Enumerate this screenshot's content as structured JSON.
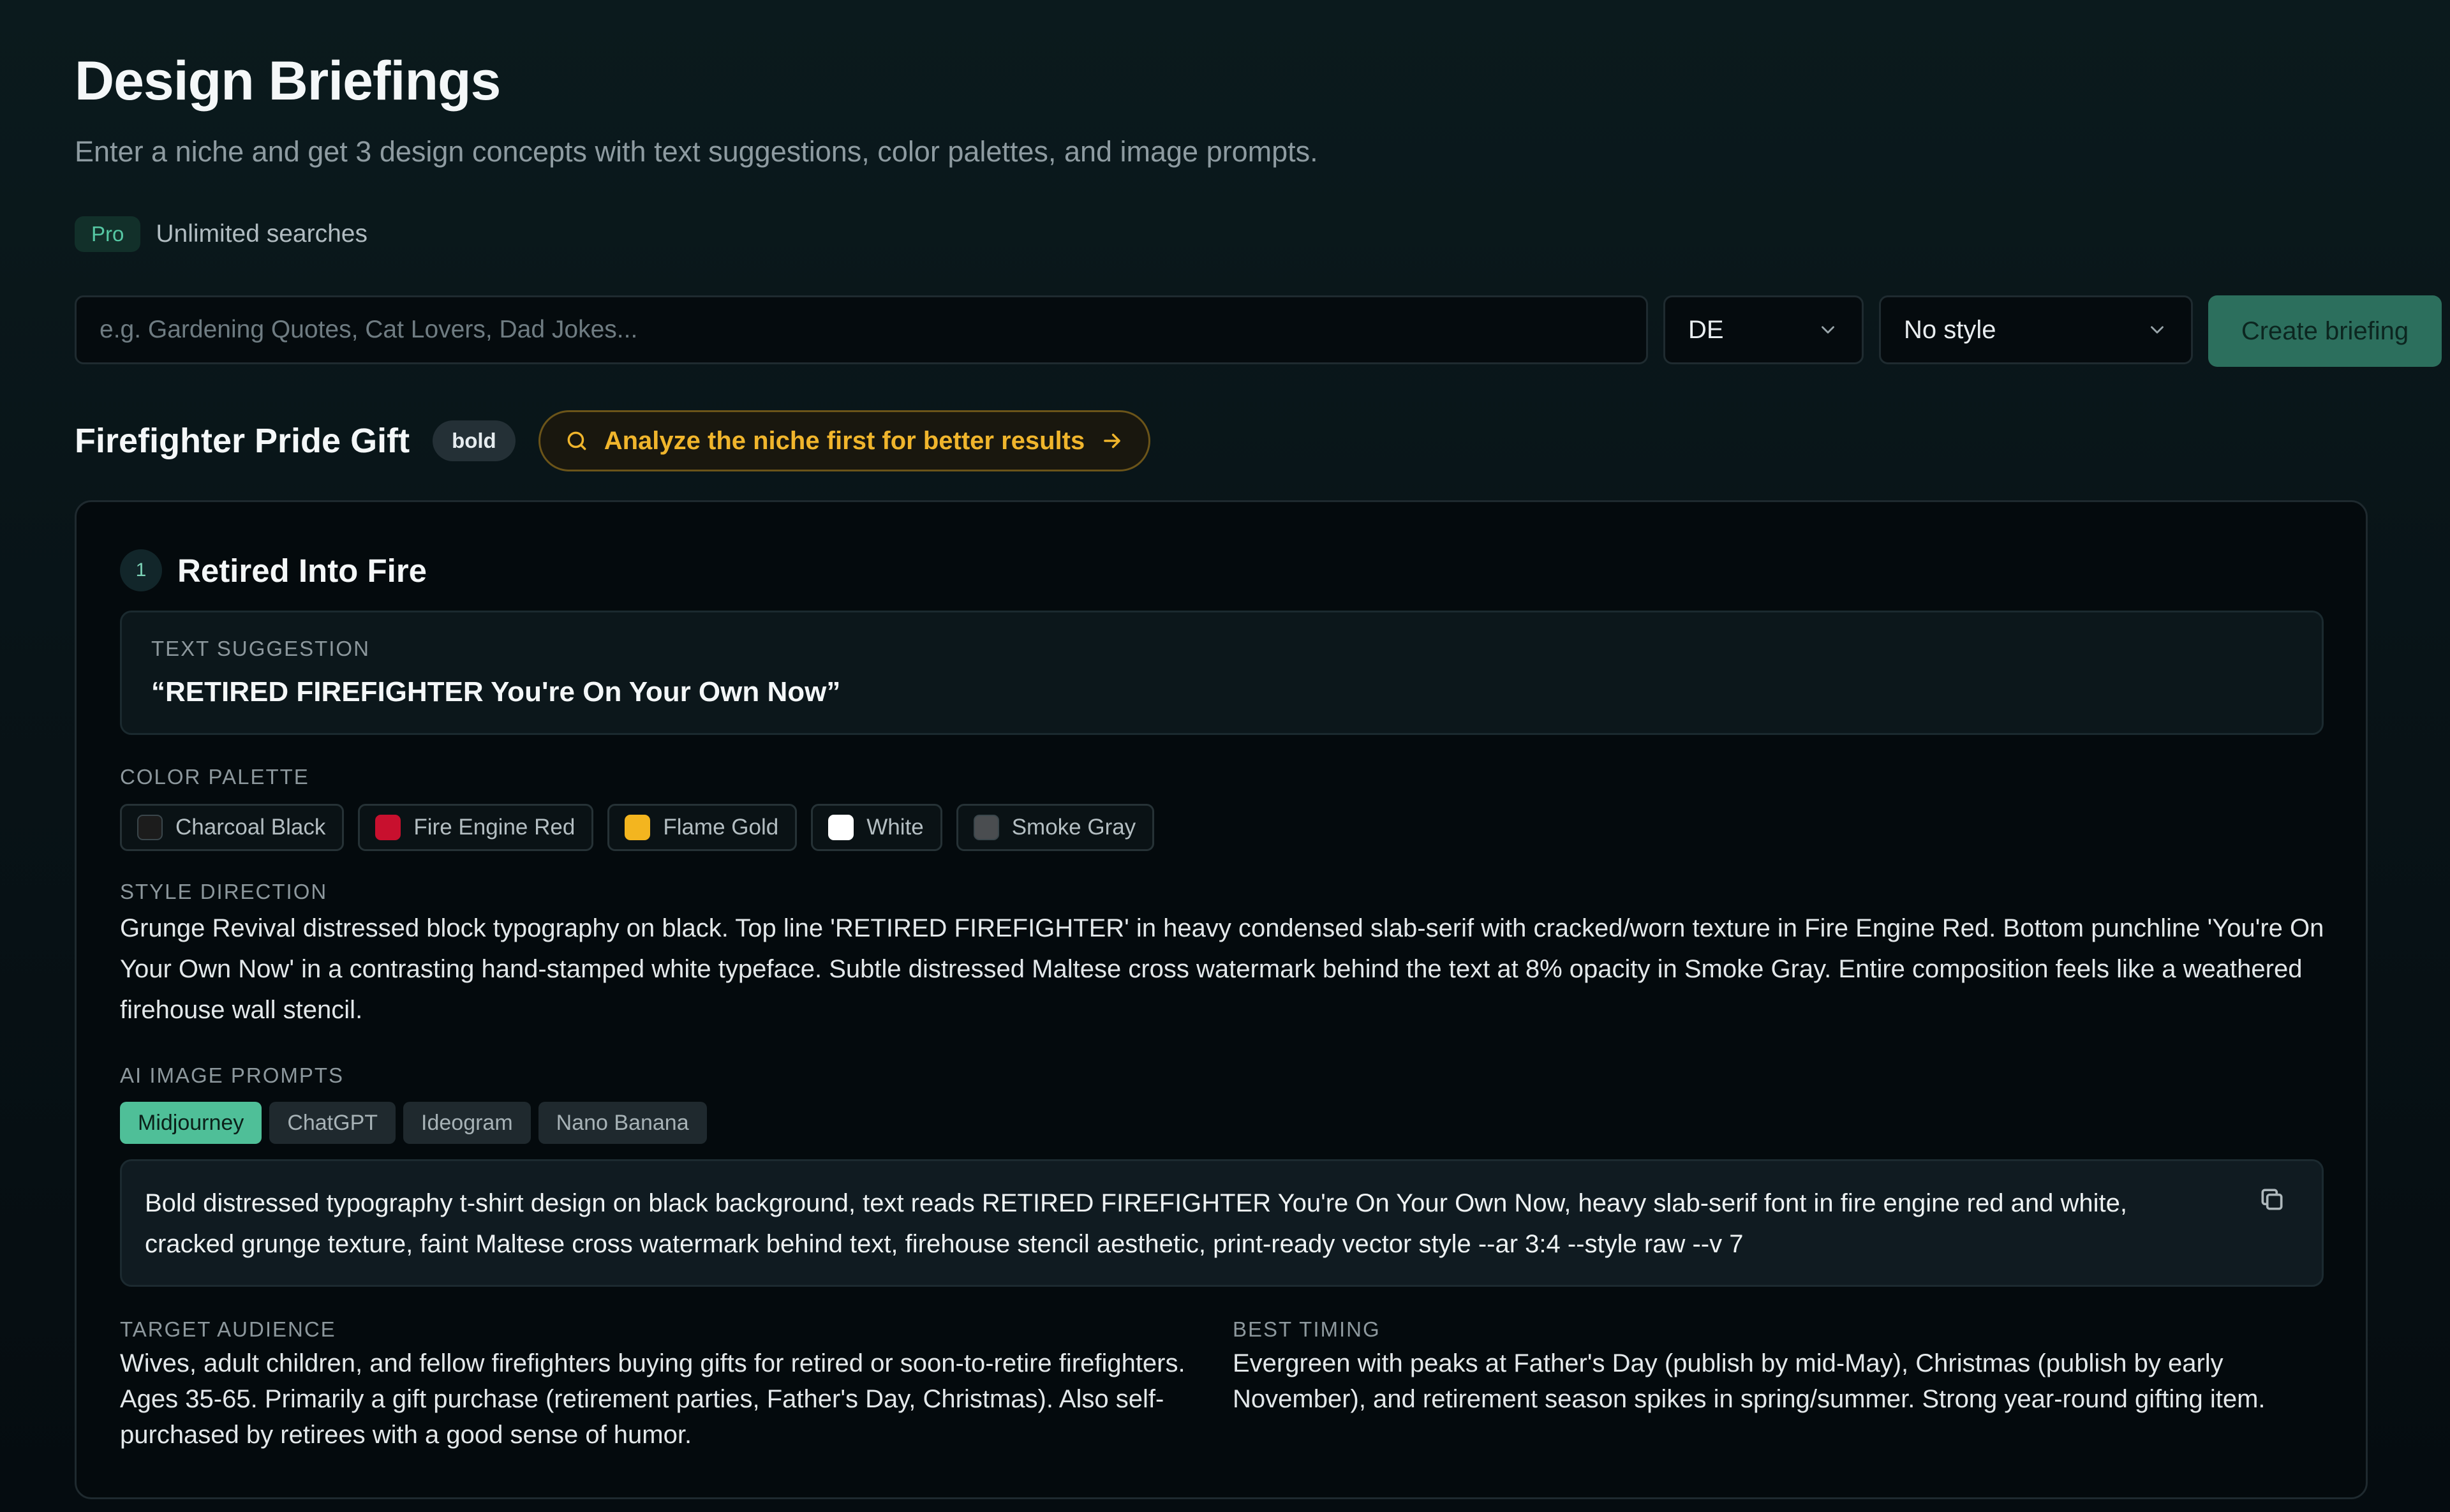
{
  "header": {
    "title": "Design Briefings",
    "subtitle": "Enter a niche and get 3 design concepts with text suggestions, color palettes, and image prompts."
  },
  "plan": {
    "badge": "Pro",
    "text": "Unlimited searches"
  },
  "search": {
    "placeholder": "e.g. Gardening Quotes, Cat Lovers, Dad Jokes...",
    "value": "",
    "language": "DE",
    "style": "No style",
    "create_label": "Create briefing"
  },
  "niche": {
    "title": "Firefighter Pride Gift",
    "tag": "bold",
    "analyze_label": "Analyze the niche first for better results"
  },
  "concept": {
    "number": "1",
    "title": "Retired Into Fire",
    "text_label": "Text Suggestion",
    "text": "“RETIRED FIREFIGHTER You're On Your Own Now”",
    "palette_label": "Color Palette",
    "palette": [
      {
        "name": "Charcoal Black",
        "color": "#1c1c1c"
      },
      {
        "name": "Fire Engine Red",
        "color": "#c8102e"
      },
      {
        "name": "Flame Gold",
        "color": "#f3b51f"
      },
      {
        "name": "White",
        "color": "#ffffff"
      },
      {
        "name": "Smoke Gray",
        "color": "#4a4d50"
      }
    ],
    "style_label": "Style Direction",
    "style_text": "Grunge Revival distressed block typography on black. Top line 'RETIRED FIREFIGHTER' in heavy condensed slab-serif with cracked/worn texture in Fire Engine Red. Bottom punchline 'You're On Your Own Now' in a contrasting hand-stamped white typeface. Subtle distressed Maltese cross watermark behind the text at 8% opacity in Smoke Gray. Entire composition feels like a weathered firehouse wall stencil.",
    "prompts_label": "AI Image Prompts",
    "prompt_tabs": [
      "Midjourney",
      "ChatGPT",
      "Ideogram",
      "Nano Banana"
    ],
    "active_tab": "Midjourney",
    "prompt_text": "Bold distressed typography t-shirt design on black background, text reads RETIRED FIREFIGHTER You're On Your Own Now, heavy slab-serif font in fire engine red and white, cracked grunge texture, faint Maltese cross watermark behind text, firehouse stencil aesthetic, print-ready vector style --ar 3:4 --style raw --v 7",
    "audience_label": "Target Audience",
    "audience_text": "Wives, adult children, and fellow firefighters buying gifts for retired or soon-to-retire firefighters. Ages 35-65. Primarily a gift purchase (retirement parties, Father's Day, Christmas). Also self-purchased by retirees with a good sense of humor.",
    "timing_label": "Best Timing",
    "timing_text": "Evergreen with peaks at Father's Day (publish by mid-May), Christmas (publish by early November), and retirement season spikes in spring/summer. Strong year-round gifting item."
  },
  "colors": {
    "accent": "#4fbf98",
    "warning": "#f0b52c",
    "background": "#081317"
  },
  "icons": {
    "analyze": "search-icon",
    "arrow": "arrow-right-icon",
    "select": "chevron-down-icon",
    "copy": "copy-icon"
  }
}
